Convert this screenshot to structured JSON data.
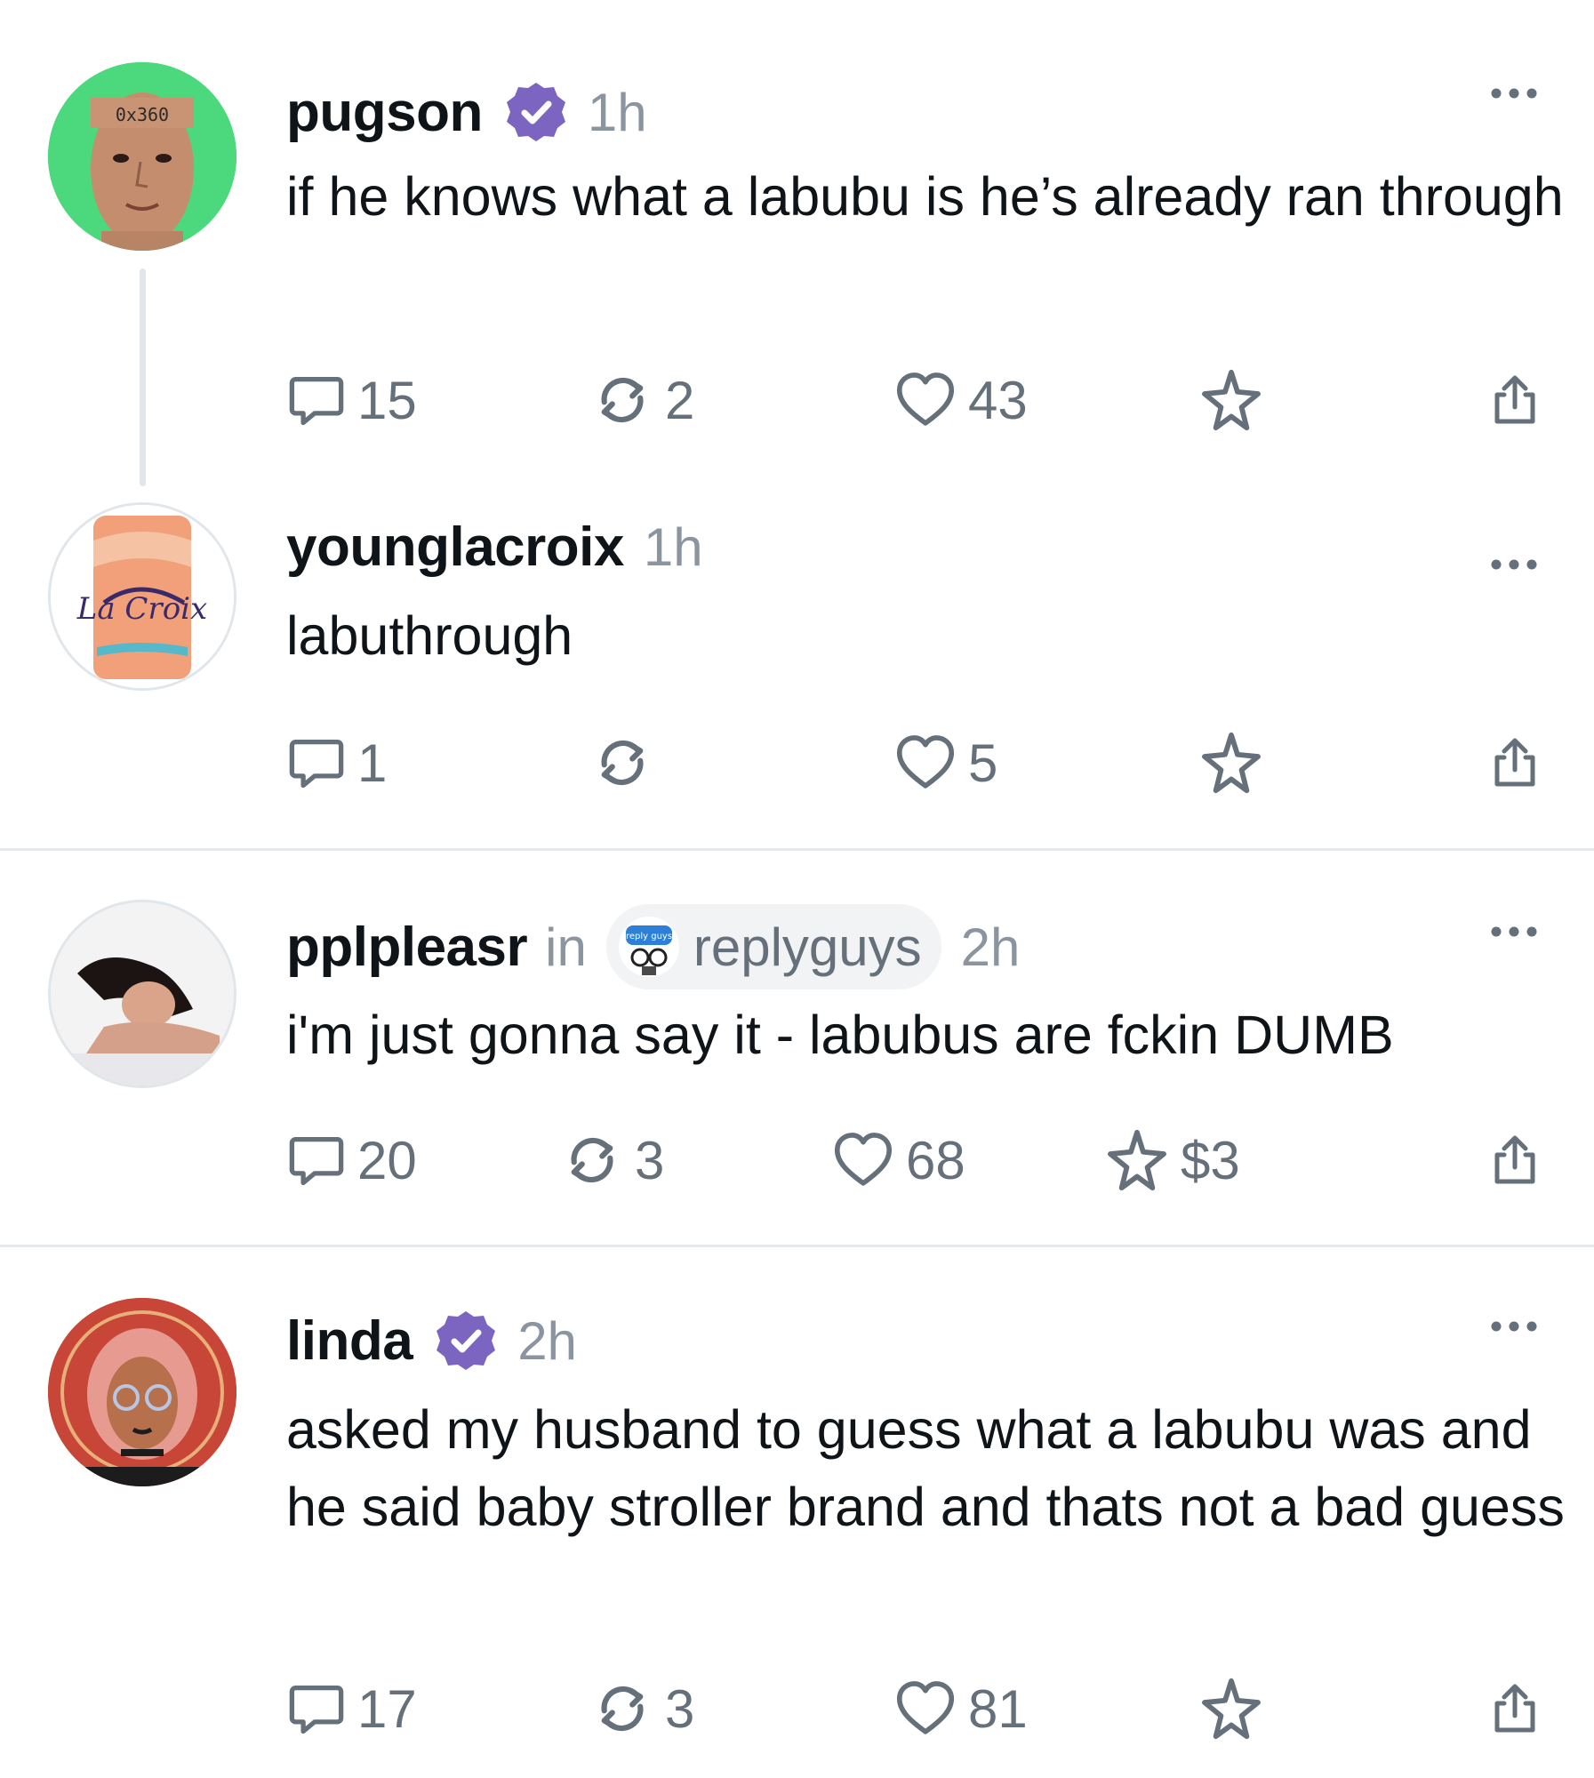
{
  "posts": [
    {
      "handle": "pugson",
      "verified": true,
      "time": "1h",
      "avatar_label": "0x360",
      "text": "if he knows what a labubu is he’s already ran through",
      "replies": "15",
      "recasts": "2",
      "likes": "43"
    },
    {
      "handle": "younglacroix",
      "verified": false,
      "time": "1h",
      "avatar_label": "La Croix",
      "text": "labuthrough",
      "replies": "1",
      "recasts": "",
      "likes": "5"
    },
    {
      "handle": "pplpleasr",
      "verified": false,
      "in_word": "in",
      "community": "replyguys",
      "community_icon_label": "reply guys",
      "time": "2h",
      "text": "i'm just gonna say it - labubus are fckin DUMB",
      "replies": "20",
      "recasts": "3",
      "likes": "68",
      "tip": "$3"
    },
    {
      "handle": "linda",
      "verified": true,
      "time": "2h",
      "text": "asked my husband to guess what a labubu was and he said baby stroller brand and thats not a bad guess",
      "replies": "17",
      "recasts": "3",
      "likes": "81"
    }
  ],
  "colors": {
    "verified_badge": "#7c65c1",
    "muted_text": "#8b95a0",
    "icon": "#66707b",
    "divider": "#e6e9ec",
    "thread_line": "#e1e6ea"
  },
  "icons": [
    "reply-icon",
    "recast-icon",
    "like-icon",
    "bookmark-star-icon",
    "share-icon",
    "more-icon",
    "verified-icon"
  ]
}
